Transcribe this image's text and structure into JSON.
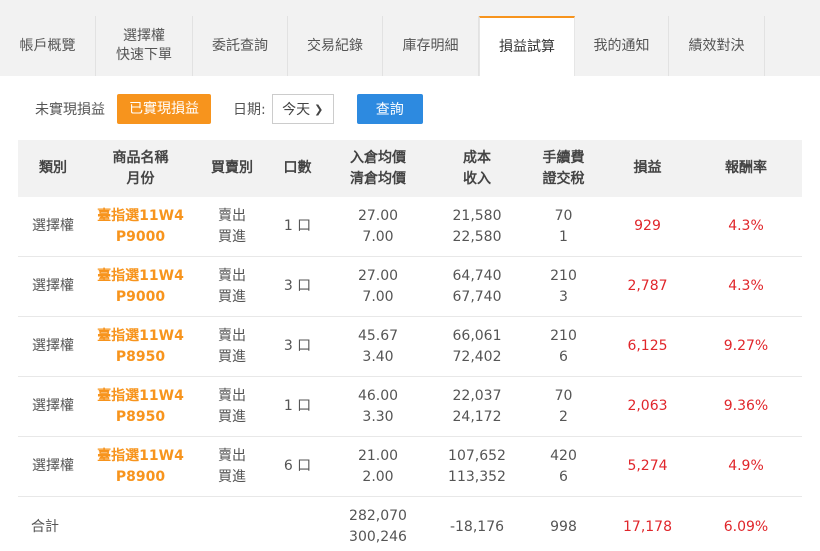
{
  "tabs": [
    {
      "label": "帳戶概覽",
      "width": 96
    },
    {
      "label": "選擇權\n快速下單",
      "width": 97
    },
    {
      "label": "委託查詢",
      "width": 95
    },
    {
      "label": "交易紀錄",
      "width": 95
    },
    {
      "label": "庫存明細",
      "width": 96
    },
    {
      "label": "損益試算",
      "width": 96
    },
    {
      "label": "我的通知",
      "width": 94
    },
    {
      "label": "績效對決",
      "width": 96
    }
  ],
  "active_tab": "損益試算",
  "filter": {
    "unrealized_label": "未實現損益",
    "realized_label": "已實現損益",
    "date_label": "日期:",
    "date_value": "今天",
    "query_label": "查詢"
  },
  "table": {
    "headers": [
      "類別",
      "商品名稱\n月份",
      "買賣別",
      "口數",
      "入倉均價\n清倉均價",
      "成本\n收入",
      "手續費\n證交稅",
      "損益",
      "報酬率"
    ],
    "rows": [
      {
        "category": "選擇權",
        "product": "臺指選11W4\nP9000",
        "side": "賣出\n買進",
        "lots": "1 口",
        "prices": "27.00\n7.00",
        "cost_income": "21,580\n22,580",
        "fee_tax": "70\n1",
        "pnl": "929",
        "return": "4.3%"
      },
      {
        "category": "選擇權",
        "product": "臺指選11W4\nP9000",
        "side": "賣出\n買進",
        "lots": "3 口",
        "prices": "27.00\n7.00",
        "cost_income": "64,740\n67,740",
        "fee_tax": "210\n3",
        "pnl": "2,787",
        "return": "4.3%"
      },
      {
        "category": "選擇權",
        "product": "臺指選11W4\nP8950",
        "side": "賣出\n買進",
        "lots": "3 口",
        "prices": "45.67\n3.40",
        "cost_income": "66,061\n72,402",
        "fee_tax": "210\n6",
        "pnl": "6,125",
        "return": "9.27%"
      },
      {
        "category": "選擇權",
        "product": "臺指選11W4\nP8950",
        "side": "賣出\n買進",
        "lots": "1 口",
        "prices": "46.00\n3.30",
        "cost_income": "22,037\n24,172",
        "fee_tax": "70\n2",
        "pnl": "2,063",
        "return": "9.36%"
      },
      {
        "category": "選擇權",
        "product": "臺指選11W4\nP8900",
        "side": "賣出\n買進",
        "lots": "6 口",
        "prices": "21.00\n2.00",
        "cost_income": "107,652\n113,352",
        "fee_tax": "420\n6",
        "pnl": "5,274",
        "return": "4.9%"
      }
    ],
    "total": {
      "label": "合計",
      "cost_income": "282,070\n300,246",
      "net": "-18,176",
      "fee": "998",
      "pnl": "17,178",
      "return": "6.09%"
    }
  },
  "colors": {
    "accent": "#f7941d",
    "query_button": "#2d8ae0",
    "loss_profit_red": "#e0262b"
  }
}
